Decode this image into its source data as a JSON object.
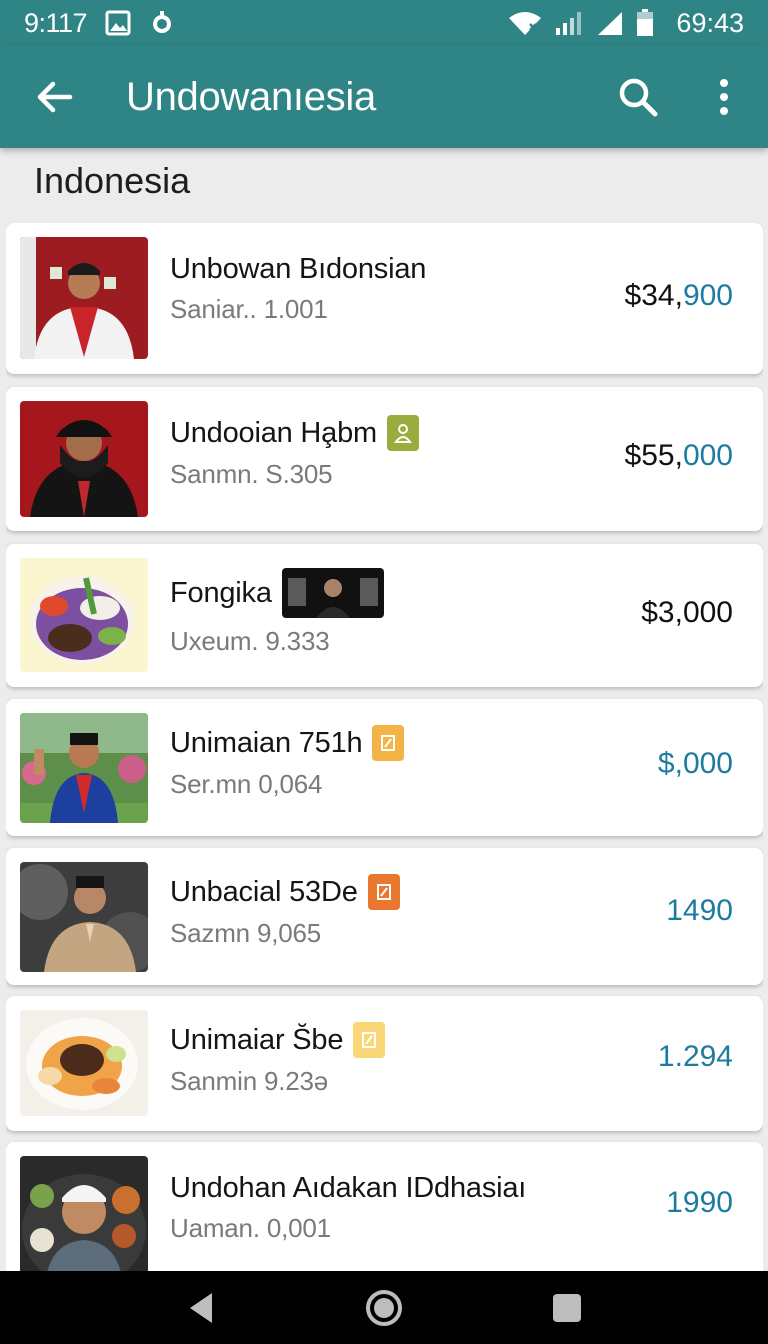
{
  "status_bar": {
    "time": "9:117",
    "clock": "69:43",
    "icons": [
      "image-icon",
      "alarm-icon",
      "wifi-icon",
      "signal-icon",
      "signal-icon",
      "battery-icon"
    ]
  },
  "app_bar": {
    "title": "Undowanıesia",
    "back_icon": "arrow-back-icon",
    "search_icon": "search-icon",
    "more_icon": "more-vert-icon"
  },
  "section": {
    "header": "Indonesia"
  },
  "items": [
    {
      "title": "Unbowan Bıdonsian",
      "subtitle": "Saniar.. 1.001",
      "price_main": "$34,",
      "price_accent": "900",
      "badge": null
    },
    {
      "title": "Undooian Ha̧bm",
      "subtitle": "Sanmn. S.305",
      "price_main": "$55,",
      "price_accent": "000",
      "badge": "olive"
    },
    {
      "title": "Fongika",
      "subtitle": "Uxeum. 9.333",
      "price_main": "$3,000",
      "price_accent": "",
      "badge": "photo"
    },
    {
      "title": "Unimaian 751h",
      "subtitle": "Ser.mn 0,064",
      "price_main": "",
      "price_accent": "$,000",
      "badge": "amber"
    },
    {
      "title": "Unbacial 53De",
      "subtitle": "Sazmn 9,065",
      "price_main": "",
      "price_accent": "1490",
      "badge": "orange"
    },
    {
      "title": "Unimaiar S̆be",
      "subtitle": "Sanmin 9.23ə",
      "price_main": "",
      "price_accent": "1.294",
      "badge": "pale"
    },
    {
      "title": "Undohan Aıdakan IDdhasiaı",
      "subtitle": "Uaman. 0,001",
      "price_main": "",
      "price_accent": "1990",
      "badge": null
    }
  ],
  "colors": {
    "app_bar": "#2f8585",
    "price_accent": "#1e7ba0",
    "badge_olive": "#9bab3d",
    "badge_amber": "#f3b345",
    "badge_orange": "#e9782e",
    "badge_pale": "#f8d774"
  },
  "nav_bar": {
    "icons": [
      "nav-back-icon",
      "nav-home-icon",
      "nav-recents-icon"
    ]
  }
}
